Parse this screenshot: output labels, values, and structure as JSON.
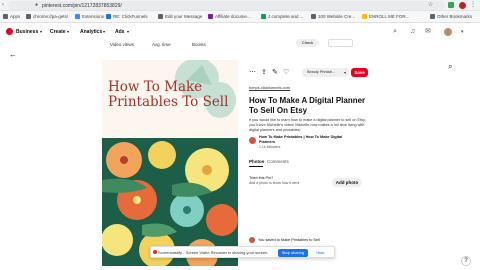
{
  "browser": {
    "url": "pinterest.com/pin/12172837853829/",
    "bookmarks": [
      "Apps",
      "chrome://pa-gets/",
      "Extensions",
      "RE: ClickFunnels",
      "Edit your Message",
      "Affiliate docume...",
      "J.complete and ...",
      "100 Website Cre...",
      "ENROLL ME FOR...",
      "Other Bookmarks"
    ],
    "bookmark_colors": [
      "#5f6368",
      "#5f6368",
      "#4285f4",
      "#1a73e8",
      "#5f6368",
      "#7b1fa2",
      "#0f9d58",
      "#5f6368",
      "#fbbc05",
      "#5f6368"
    ]
  },
  "header": {
    "menus": [
      "Business",
      "Create",
      "Analytics",
      "Ads"
    ],
    "strip": [
      "Video views",
      "Avg. time",
      "Boosts"
    ],
    "check_label": "Check"
  },
  "pin": {
    "image_title": "How To Make Printables To Sell",
    "board_select": "Beauty Printab...",
    "save_label": "Save",
    "link": "fcmps.clickfunnels.com",
    "heading": "How To Make A Digital Planner To Sell On Etsy",
    "description": "If you would like to learn how to make a digital planner to sell on Etsy, you'll love Michelle's video! Michelle now makes a full time living with digital planners and printables!",
    "author_name": "How To Make Printables | How To Make Digital Planners",
    "followers": "1.1k followers",
    "tabs": [
      "Photos",
      "Comments"
    ],
    "tried_question": "Tried this Pin?",
    "tried_sub": "Add a photo to show how it went",
    "add_photo_label": "Add photo",
    "saved_line": "You saved to Make Printables to Sell"
  },
  "share_banner": {
    "message": "Screencastify - Screen Video Recorder is sharing your screen.",
    "stop_label": "Stop sharing",
    "hide_label": "Hide"
  },
  "colors": {
    "pinterest_red": "#e60023",
    "pin_title": "#a3322d",
    "share_blue": "#1a73e8"
  }
}
